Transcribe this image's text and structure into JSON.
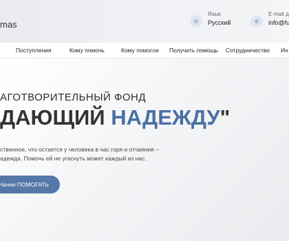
{
  "header": {
    "logo_text": "mas",
    "language_label": "Язык",
    "language_value": "Русский",
    "email_label": "E-mail для",
    "email_value": "info@fun"
  },
  "nav": {
    "items": [
      "Поступления",
      "Кому помочь",
      "Кому помогли",
      "Получить помощь",
      "Сотрудничество",
      "Ин"
    ]
  },
  "hero": {
    "subtitle": "АГОТВОРИТЕЛЬНЫЙ ФОНД",
    "title_part1": "ДАЮЩИЙ ",
    "title_accent": "НАДЕЖДУ",
    "title_end": "\"",
    "desc_line1": "ственное, что остается у человека в час горя и отчаяния –",
    "desc_line2": "адежда. Помочь ей не угаснуть может каждый из нас.",
    "button_label": "Начни ПОМОГАТЬ"
  },
  "colors": {
    "accent": "#4a70a3",
    "button": "#5578a8"
  }
}
